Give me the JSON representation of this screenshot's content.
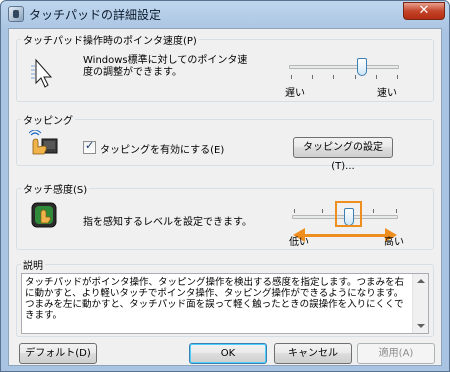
{
  "window": {
    "title": "タッチパッドの詳細設定",
    "close_glyph": "✕"
  },
  "pointer_speed": {
    "group_label": "タッチパッド操作時のポインタ速度(P)",
    "description": "Windows標準に対してのポインタ速度の調整ができます。",
    "slider": {
      "min_label": "遅い",
      "max_label": "速い",
      "level": 0.67
    }
  },
  "tapping": {
    "group_label": "タッピング",
    "enable_checkbox": {
      "label": "タッピングを有効にする(E)",
      "checked": true
    },
    "settings_button": "タッピングの設定(T)..."
  },
  "sensitivity": {
    "group_label": "タッチ感度(S)",
    "description": "指を感知するレベルを設定できます。",
    "slider": {
      "min_label": "低い",
      "max_label": "高い",
      "level": 0.5
    }
  },
  "explanation": {
    "group_label": "説明",
    "text": "タッチパッドがポインタ操作、タッピング操作を検出する感度を指定します。つまみを右に動かすと、より軽いタッチでポインタ操作、タッピング操作ができるようになります。つまみを左に動かすと、タッチパッド面を誤って軽く触ったときの誤操作を入りにくくできます。"
  },
  "buttons": {
    "default": "デフォルト(D)",
    "ok": "OK",
    "cancel": "キャンセル",
    "apply": "適用(A)"
  },
  "colors": {
    "highlight": "#ee8e1f",
    "title_bar": "#a9c4e2",
    "close_button": "#c4442a"
  }
}
